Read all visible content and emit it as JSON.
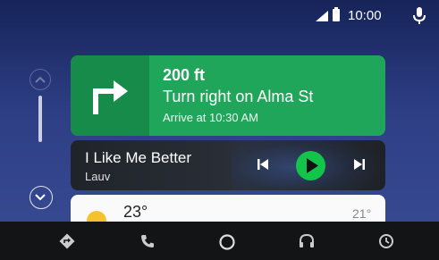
{
  "status_bar": {
    "time": "10:00",
    "icons": [
      "signal-icon",
      "battery-icon",
      "microphone-icon"
    ]
  },
  "rail": {
    "icons": [
      "chevron-up-icon",
      "chevron-down-icon"
    ]
  },
  "navigation_card": {
    "distance": "200 ft",
    "instruction": "Turn right on Alma St",
    "arrival": "Arrive at 10:30 AM",
    "icon": "turn-right-arrow-icon",
    "colors": {
      "card": "#1fa65a",
      "turn_panel": "#178b49"
    }
  },
  "media_card": {
    "title": "I Like Me Better",
    "artist": "Lauv",
    "icons": [
      "skip-previous-icon",
      "play-icon",
      "skip-next-icon"
    ],
    "colors": {
      "play_button": "#12c44a"
    }
  },
  "weather_card": {
    "temperature": "23°",
    "low": "21°",
    "icon": "sun-icon"
  },
  "nav_bar": {
    "items": [
      "directions-icon",
      "phone-icon",
      "home-icon",
      "headphones-icon",
      "notifications-icon"
    ]
  }
}
